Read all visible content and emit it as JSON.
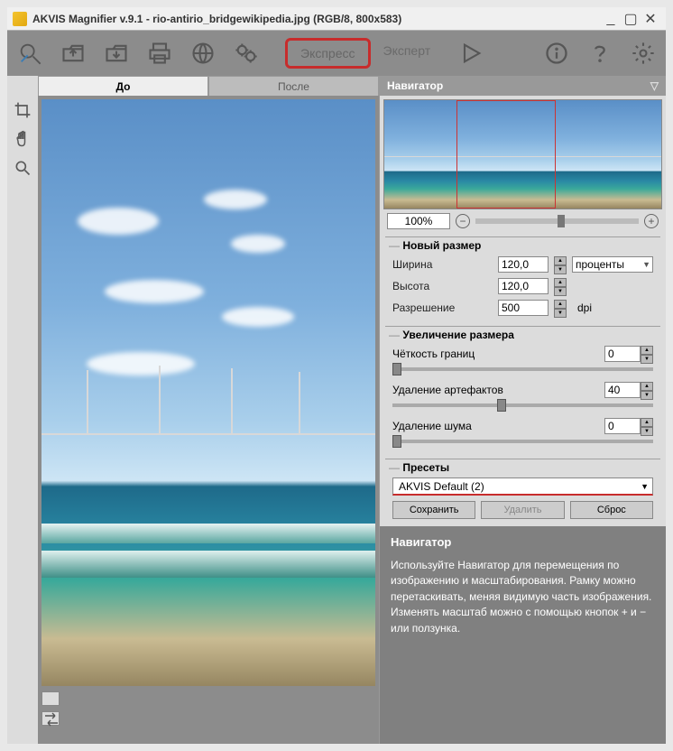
{
  "titlebar": {
    "text": "AKVIS Magnifier v.9.1 - rio-antirio_bridgewikipedia.jpg (RGB/8, 800x583)"
  },
  "tabs": {
    "before": "До",
    "after": "После"
  },
  "modes": {
    "express": "Экспресс",
    "expert": "Эксперт"
  },
  "navigator": {
    "header": "Навигатор",
    "zoom": "100%"
  },
  "newSize": {
    "header": "Новый размер",
    "widthLabel": "Ширина",
    "widthValue": "120,0",
    "heightLabel": "Высота",
    "heightValue": "120,0",
    "resLabel": "Разрешение",
    "resValue": "500",
    "unit": "проценты",
    "dpi": "dpi"
  },
  "upsize": {
    "header": "Увеличение размера",
    "sharpLabel": "Чёткость границ",
    "sharpValue": "0",
    "artLabel": "Удаление артефактов",
    "artValue": "40",
    "noiseLabel": "Удаление шума",
    "noiseValue": "0"
  },
  "presets": {
    "header": "Пресеты",
    "value": "AKVIS Default (2)",
    "save": "Сохранить",
    "delete": "Удалить",
    "reset": "Сброс"
  },
  "help": {
    "title": "Навигатор",
    "body": "Используйте Навигатор для перемещения по изображению и масштабирования. Рамку можно перетаскивать, меняя видимую часть изображения. Изменять масштаб можно с помощью кнопок + и − или ползунка."
  }
}
